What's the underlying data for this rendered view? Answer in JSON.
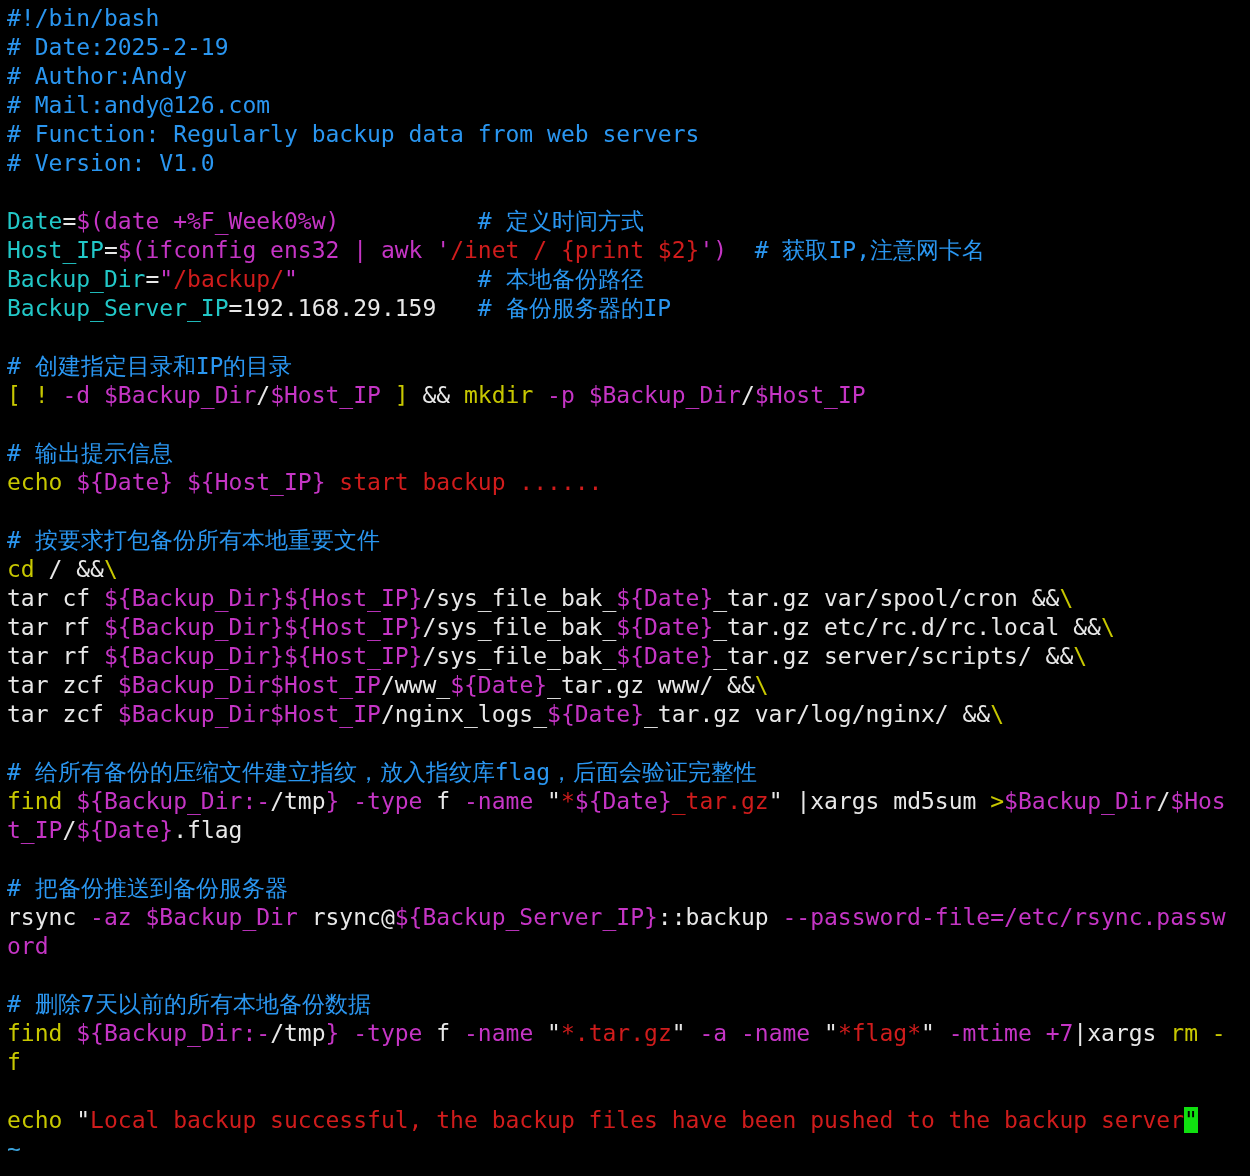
{
  "blocks": [
    {
      "lines": [
        {
          "segments": [
            {
              "text": "#!/bin/bash",
              "kind": "comment"
            }
          ]
        },
        {
          "segments": [
            {
              "text": "# Date:2025-2-19",
              "kind": "comment"
            }
          ]
        },
        {
          "segments": [
            {
              "text": "# Author:Andy",
              "kind": "comment"
            }
          ]
        },
        {
          "segments": [
            {
              "text": "# Mail:andy@126.com",
              "kind": "comment"
            }
          ]
        },
        {
          "segments": [
            {
              "text": "# Function: Regularly backup data from web servers",
              "kind": "comment"
            }
          ]
        },
        {
          "segments": [
            {
              "text": "# Version: V1.0",
              "kind": "comment"
            }
          ]
        }
      ]
    },
    {
      "lines": [
        {
          "segments": [
            {
              "text": "Date",
              "kind": "identifier"
            },
            {
              "text": "=",
              "kind": "plain"
            },
            {
              "text": "$(date +%F_Week0%w)",
              "kind": "expansion"
            },
            {
              "text": "          # 定义时间方式",
              "kind": "comment"
            }
          ]
        },
        {
          "segments": [
            {
              "text": "Host_IP",
              "kind": "identifier"
            },
            {
              "text": "=",
              "kind": "plain"
            },
            {
              "text": "$(ifconfig ens32 | awk '",
              "kind": "expansion"
            },
            {
              "text": "/inet / {print $2}",
              "kind": "string"
            },
            {
              "text": "')",
              "kind": "expansion"
            },
            {
              "text": "  # 获取IP,注意网卡名",
              "kind": "comment"
            }
          ]
        },
        {
          "segments": [
            {
              "text": "Backup_Dir",
              "kind": "identifier"
            },
            {
              "text": "=",
              "kind": "plain"
            },
            {
              "text": "\"",
              "kind": "expansion"
            },
            {
              "text": "/backup/",
              "kind": "string"
            },
            {
              "text": "\"",
              "kind": "expansion"
            },
            {
              "text": "             # 本地备份路径",
              "kind": "comment"
            }
          ]
        },
        {
          "segments": [
            {
              "text": "Backup_Server_IP",
              "kind": "identifier"
            },
            {
              "text": "=192.168.29.159   ",
              "kind": "plain"
            },
            {
              "text": "# 备份服务器的IP",
              "kind": "comment"
            }
          ]
        }
      ]
    },
    {
      "lines": [
        {
          "segments": [
            {
              "text": "# 创建指定目录和IP的目录",
              "kind": "comment"
            }
          ]
        },
        {
          "segments": [
            {
              "text": "[ ! ",
              "kind": "keyword"
            },
            {
              "text": "-d $Backup_Dir",
              "kind": "expansion"
            },
            {
              "text": "/",
              "kind": "plain"
            },
            {
              "text": "$Host_IP",
              "kind": "expansion"
            },
            {
              "text": " ]",
              "kind": "keyword"
            },
            {
              "text": " && ",
              "kind": "plain"
            },
            {
              "text": "mkdir",
              "kind": "keyword"
            },
            {
              "text": " -p $Backup_Dir",
              "kind": "expansion"
            },
            {
              "text": "/",
              "kind": "plain"
            },
            {
              "text": "$Host_IP",
              "kind": "expansion"
            }
          ]
        }
      ]
    },
    {
      "lines": [
        {
          "segments": [
            {
              "text": "# 输出提示信息",
              "kind": "comment"
            }
          ]
        },
        {
          "segments": [
            {
              "text": "echo ",
              "kind": "keyword"
            },
            {
              "text": "${Date} ${Host_IP}",
              "kind": "expansion"
            },
            {
              "text": " start backup ......",
              "kind": "string"
            }
          ]
        }
      ]
    },
    {
      "lines": [
        {
          "segments": [
            {
              "text": "# 按要求打包备份所有本地重要文件",
              "kind": "comment"
            }
          ]
        },
        {
          "segments": [
            {
              "text": "cd",
              "kind": "keyword"
            },
            {
              "text": " / &&",
              "kind": "plain"
            },
            {
              "text": "\\",
              "kind": "keyword"
            }
          ]
        },
        {
          "segments": [
            {
              "text": "tar cf ",
              "kind": "plain"
            },
            {
              "text": "${Backup_Dir}${Host_IP}",
              "kind": "expansion"
            },
            {
              "text": "/sys_file_bak_",
              "kind": "plain"
            },
            {
              "text": "${Date}",
              "kind": "expansion"
            },
            {
              "text": "_tar.gz var/spool/cron &&",
              "kind": "plain"
            },
            {
              "text": "\\",
              "kind": "keyword"
            }
          ]
        },
        {
          "segments": [
            {
              "text": "tar rf ",
              "kind": "plain"
            },
            {
              "text": "${Backup_Dir}${Host_IP}",
              "kind": "expansion"
            },
            {
              "text": "/sys_file_bak_",
              "kind": "plain"
            },
            {
              "text": "${Date}",
              "kind": "expansion"
            },
            {
              "text": "_tar.gz etc/rc.d/rc.local &&",
              "kind": "plain"
            },
            {
              "text": "\\",
              "kind": "keyword"
            }
          ]
        },
        {
          "segments": [
            {
              "text": "tar rf ",
              "kind": "plain"
            },
            {
              "text": "${Backup_Dir}${Host_IP}",
              "kind": "expansion"
            },
            {
              "text": "/sys_file_bak_",
              "kind": "plain"
            },
            {
              "text": "${Date}",
              "kind": "expansion"
            },
            {
              "text": "_tar.gz server/scripts/ &&",
              "kind": "plain"
            },
            {
              "text": "\\",
              "kind": "keyword"
            }
          ]
        },
        {
          "segments": [
            {
              "text": "tar zcf ",
              "kind": "plain"
            },
            {
              "text": "$Backup_Dir$Host_IP",
              "kind": "expansion"
            },
            {
              "text": "/www_",
              "kind": "plain"
            },
            {
              "text": "${Date}",
              "kind": "expansion"
            },
            {
              "text": "_tar.gz www/ &&",
              "kind": "plain"
            },
            {
              "text": "\\",
              "kind": "keyword"
            }
          ]
        },
        {
          "segments": [
            {
              "text": "tar zcf ",
              "kind": "plain"
            },
            {
              "text": "$Backup_Dir$Host_IP",
              "kind": "expansion"
            },
            {
              "text": "/nginx_logs_",
              "kind": "plain"
            },
            {
              "text": "${Date}",
              "kind": "expansion"
            },
            {
              "text": "_tar.gz var/log/nginx/ &&",
              "kind": "plain"
            },
            {
              "text": "\\",
              "kind": "keyword"
            }
          ]
        }
      ]
    },
    {
      "lines": [
        {
          "segments": [
            {
              "text": "# 给所有备份的压缩文件建立指纹，放入指纹库flag，后面会验证完整性",
              "kind": "comment"
            }
          ]
        },
        {
          "segments": [
            {
              "text": "find ",
              "kind": "keyword"
            },
            {
              "text": "${Backup_Dir:-",
              "kind": "expansion"
            },
            {
              "text": "/tmp",
              "kind": "plain"
            },
            {
              "text": "} -type",
              "kind": "expansion"
            },
            {
              "text": " f ",
              "kind": "plain"
            },
            {
              "text": "-name",
              "kind": "expansion"
            },
            {
              "text": " \"",
              "kind": "plain"
            },
            {
              "text": "*",
              "kind": "string"
            },
            {
              "text": "${Date}",
              "kind": "expansion"
            },
            {
              "text": "_tar.gz",
              "kind": "string"
            },
            {
              "text": "\" |xargs md5sum ",
              "kind": "plain"
            },
            {
              "text": ">",
              "kind": "keyword"
            },
            {
              "text": "$Backup_Dir",
              "kind": "expansion"
            },
            {
              "text": "/",
              "kind": "plain"
            },
            {
              "text": "$Hos",
              "kind": "expansion"
            }
          ]
        },
        {
          "segments": [
            {
              "text": "t_IP",
              "kind": "expansion"
            },
            {
              "text": "/",
              "kind": "plain"
            },
            {
              "text": "${Date}",
              "kind": "expansion"
            },
            {
              "text": ".flag",
              "kind": "plain"
            }
          ]
        }
      ]
    },
    {
      "lines": [
        {
          "segments": [
            {
              "text": "# 把备份推送到备份服务器",
              "kind": "comment"
            }
          ]
        },
        {
          "segments": [
            {
              "text": "rsync ",
              "kind": "plain"
            },
            {
              "text": "-az $Backup_Dir",
              "kind": "expansion"
            },
            {
              "text": " rsync@",
              "kind": "plain"
            },
            {
              "text": "${Backup_Server_IP}",
              "kind": "expansion"
            },
            {
              "text": "::backup ",
              "kind": "plain"
            },
            {
              "text": "--password-file=/etc/rsync.passw",
              "kind": "expansion"
            }
          ]
        },
        {
          "segments": [
            {
              "text": "ord",
              "kind": "expansion"
            }
          ]
        }
      ]
    },
    {
      "lines": [
        {
          "segments": [
            {
              "text": "# 删除7天以前的所有本地备份数据",
              "kind": "comment"
            }
          ]
        },
        {
          "segments": [
            {
              "text": "find ",
              "kind": "keyword"
            },
            {
              "text": "${Backup_Dir:-",
              "kind": "expansion"
            },
            {
              "text": "/tmp",
              "kind": "plain"
            },
            {
              "text": "} -type",
              "kind": "expansion"
            },
            {
              "text": " f ",
              "kind": "plain"
            },
            {
              "text": "-name",
              "kind": "expansion"
            },
            {
              "text": " \"",
              "kind": "plain"
            },
            {
              "text": "*.tar.gz",
              "kind": "string"
            },
            {
              "text": "\" ",
              "kind": "plain"
            },
            {
              "text": "-a -name",
              "kind": "expansion"
            },
            {
              "text": " \"",
              "kind": "plain"
            },
            {
              "text": "*flag*",
              "kind": "string"
            },
            {
              "text": "\" ",
              "kind": "plain"
            },
            {
              "text": "-mtime +7",
              "kind": "expansion"
            },
            {
              "text": "|xargs ",
              "kind": "plain"
            },
            {
              "text": "rm -",
              "kind": "keyword"
            }
          ]
        },
        {
          "segments": [
            {
              "text": "f",
              "kind": "keyword"
            }
          ]
        }
      ]
    },
    {
      "lines": [
        {
          "segments": [
            {
              "text": "echo",
              "kind": "keyword"
            },
            {
              "text": " \"",
              "kind": "plain"
            },
            {
              "text": "Local backup successful, the backup files have been pushed to the backup server",
              "kind": "string"
            },
            {
              "text": "\"",
              "kind": "cursor"
            }
          ]
        }
      ]
    }
  ],
  "end_marker": "~"
}
